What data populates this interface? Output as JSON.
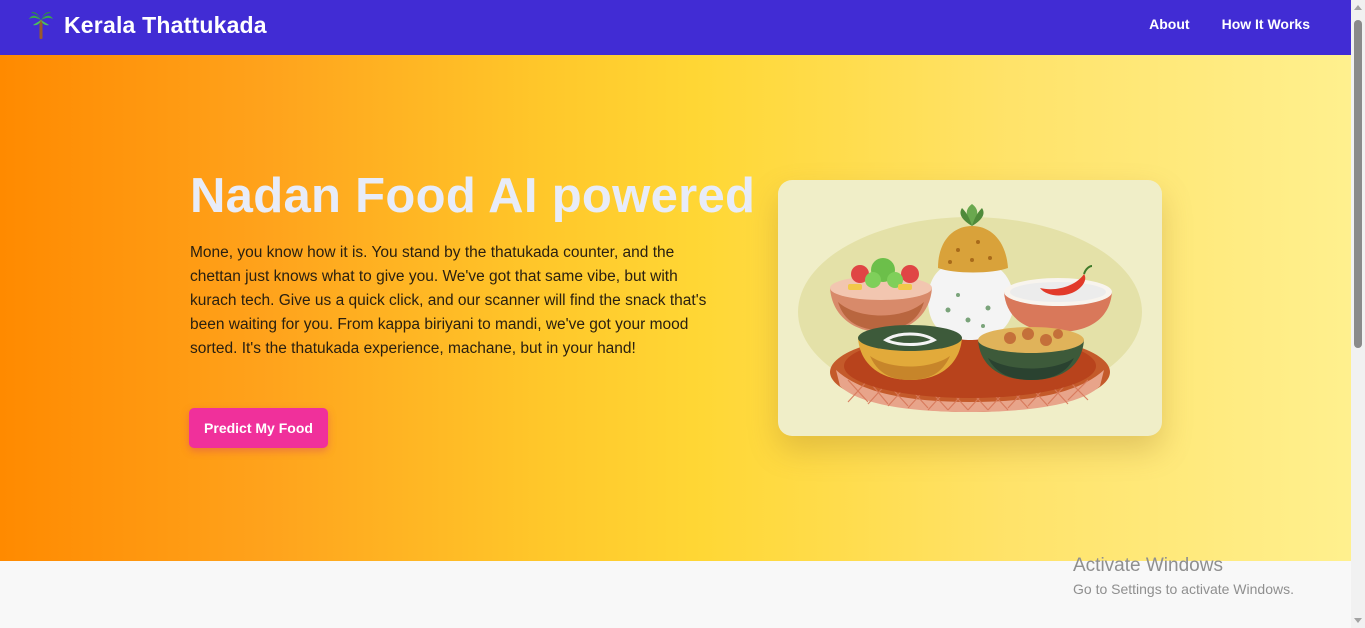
{
  "nav": {
    "brand_icon": "palm-tree-icon",
    "brand": "Kerala Thattukada",
    "links": [
      "About",
      "How It Works"
    ]
  },
  "hero": {
    "title": "Nadan Food AI powered",
    "description": "Mone, you know how it is. You stand by the thatukada counter, and the chettan just knows what to give you. We've got that same vibe, but with kurach tech. Give us a quick click, and our scanner will find the snack that's been waiting for you. From kappa biriyani to mandi, we've got your mood sorted. It's the thatukada experience, machane, but in your hand!",
    "cta": "Predict My Food",
    "image": "kerala-thali-illustration"
  },
  "colors": {
    "nav_bg": "#412cd4",
    "cta_bg": "#f0309b",
    "hero_gradient_start": "#ff8a00",
    "hero_gradient_end": "#fff08e"
  },
  "watermark": {
    "title": "Activate Windows",
    "subtitle": "Go to Settings to activate Windows."
  }
}
